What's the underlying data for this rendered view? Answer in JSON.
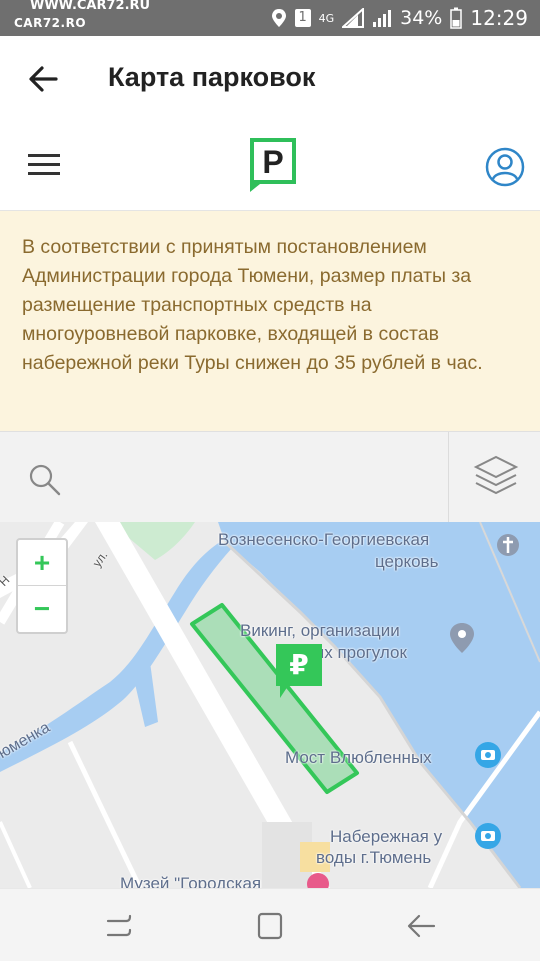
{
  "status_bar": {
    "watermark_top": "WWW.CAR72.RU",
    "watermark_logo": "CAR72.RO",
    "sim_slot": "1",
    "network": "4G",
    "battery": "34%",
    "time": "12:29"
  },
  "app_bar": {
    "title": "Карта парковок"
  },
  "notice": {
    "text": "В соответствии с принятым постановлением Администрации города Тюмени, размер платы за размещение транспортных средств на многоуровневой парковке, входящей в состав набережной реки Туры снижен до 35 рублей в час."
  },
  "zoom": {
    "in_label": "+",
    "out_label": "−"
  },
  "map": {
    "labels": {
      "church": "Вознесенско-Георгиевская",
      "church_2": "церковь",
      "viking": "Викинг, организации",
      "viking_2": "ых прогулок",
      "bridge": "Мост Влюбленных",
      "embankment": "Набережная у",
      "embankment_2": "воды г.Тюмень",
      "museum": "Музей \"Городская",
      "street_left": "Н",
      "street_left_2": "ул.",
      "river": "юменка"
    },
    "parking_zone_symbol": "₽"
  },
  "colors": {
    "brand_green": "#2fbf5a",
    "accent_blue": "#2f86c8",
    "notice_bg": "#fcf4de",
    "notice_text": "#8a6a2f",
    "water": "#a7cdf2",
    "map_bg": "#ebebeb"
  },
  "icons": {
    "back": "arrow-left-icon",
    "menu": "hamburger-icon",
    "logo": "parking-logo-icon",
    "account": "user-circle-icon",
    "search": "search-icon",
    "layers": "layers-icon"
  }
}
